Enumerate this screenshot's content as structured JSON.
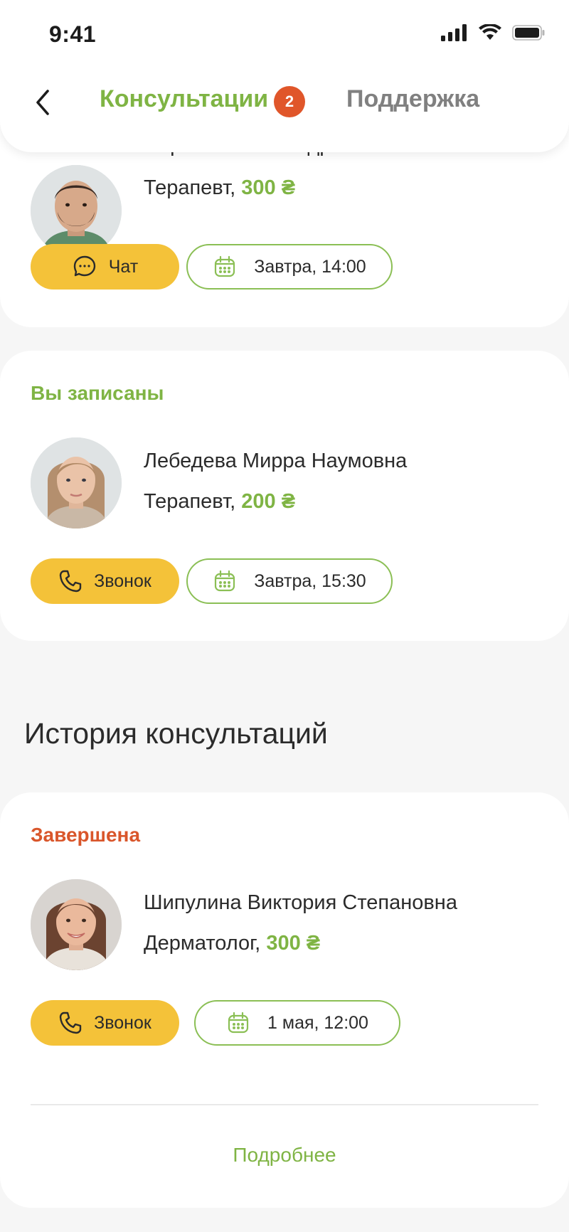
{
  "status_bar": {
    "time": "9:41"
  },
  "header": {
    "tab_active": "Консультации",
    "badge_count": "2",
    "tab_inactive": "Поддержка"
  },
  "cards": [
    {
      "partial_name": "Сергеев Иван Андреевич",
      "specialty": "Терапевт,",
      "price": "300 ₴",
      "type_label": "Чат",
      "type_icon": "chat-icon",
      "date": "Завтра, 14:00"
    },
    {
      "status": "Вы записаны",
      "name": "Лебедева Мирра Наумовна",
      "specialty": "Терапевт,",
      "price": "200 ₴",
      "type_label": "Звонок",
      "type_icon": "phone-icon",
      "date": "Завтра, 15:30"
    }
  ],
  "history": {
    "title": "История консультаций",
    "card": {
      "status": "Завершена",
      "name": "Шипулина Виктория Степановна",
      "specialty": "Дерматолог,",
      "price": "300 ₴",
      "type_label": "Звонок",
      "type_icon": "phone-icon",
      "date": "1 мая, 12:00",
      "more": "Подробнее"
    }
  },
  "colors": {
    "accent_green": "#7fb444",
    "badge_red": "#e0562a",
    "button_yellow": "#f4c239",
    "status_red": "#d9562b"
  }
}
